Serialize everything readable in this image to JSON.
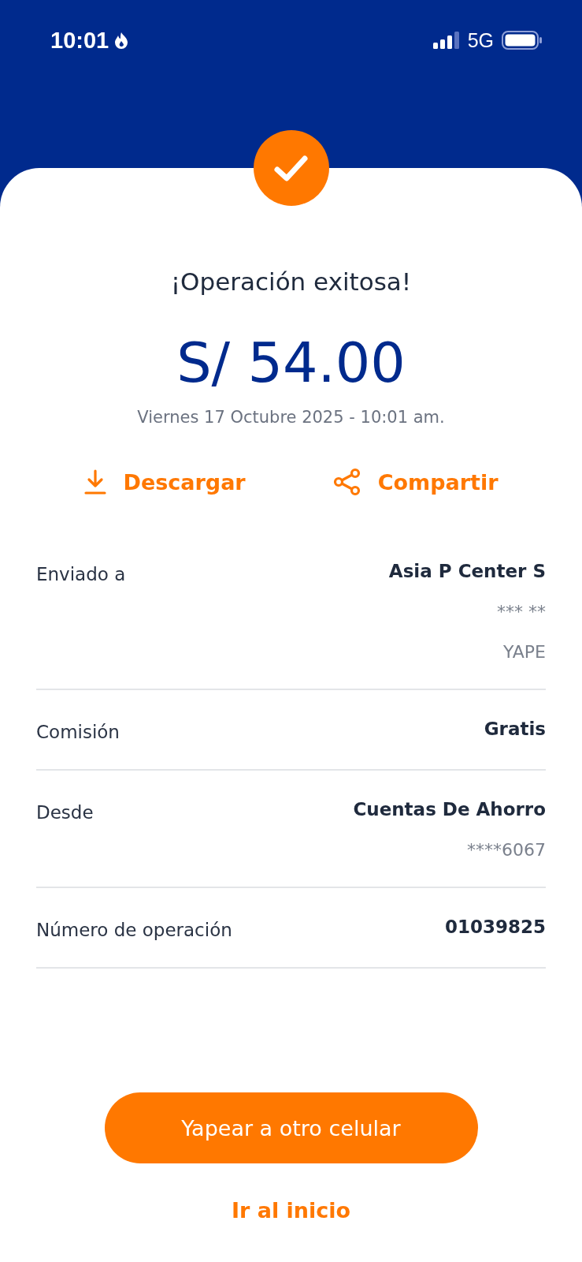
{
  "status_bar": {
    "time": "10:01",
    "network": "5G"
  },
  "title": "¡Operación exitosa!",
  "amount": "S/ 54.00",
  "date": "Viernes 17 Octubre 2025 - 10:01 am.",
  "actions": [
    {
      "kind": "download",
      "label": "Descargar"
    },
    {
      "kind": "share",
      "label": "Compartir"
    }
  ],
  "details": [
    {
      "label": "Enviado a",
      "values": [
        {
          "kind": "primary",
          "text": "Asia P Center S"
        },
        {
          "kind": "secondary",
          "text": "*** **"
        },
        {
          "kind": "secondary",
          "text": "YAPE"
        }
      ]
    },
    {
      "label": "Comisión",
      "values": [
        {
          "kind": "primary",
          "text": "Gratis"
        }
      ]
    },
    {
      "label": "Desde",
      "values": [
        {
          "kind": "primary",
          "text": "Cuentas De Ahorro"
        },
        {
          "kind": "secondary",
          "text": "****6067"
        }
      ]
    },
    {
      "label": "Número de operación",
      "values": [
        {
          "kind": "primary",
          "text": "01039825"
        }
      ]
    }
  ],
  "primary_button": "Yapear a otro celular",
  "link": "Ir al inicio"
}
